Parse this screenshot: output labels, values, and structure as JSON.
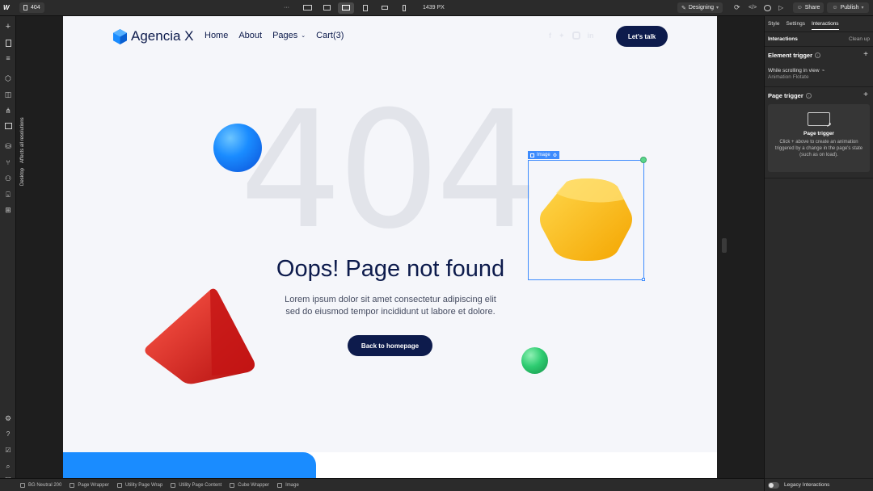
{
  "topbar": {
    "page_name": "404",
    "more": "···",
    "width_readout": "1439 PX",
    "mode_label": "Designing",
    "share_label": "Share",
    "publish_label": "Publish"
  },
  "canvas_side": {
    "affects_label": "Affects all resolutions",
    "breakpoint_label": "Desktop"
  },
  "site": {
    "brand": "Agencia X",
    "nav": [
      "Home",
      "About",
      "Pages",
      "Cart(3)"
    ],
    "cta": "Let's talk",
    "big_number": "404",
    "heading": "Oops! Page not found",
    "body_line1": "Lorem ipsum dolor sit amet consectetur adipiscing elit",
    "body_line2": "sed do eiusmod tempor incididunt ut labore et dolore.",
    "back_button": "Back to homepage",
    "selection_tag": "Image"
  },
  "rightpanel": {
    "tabs": [
      "Style",
      "Settings",
      "Interactions"
    ],
    "active_tab": "Interactions",
    "section_title": "Interactions",
    "cleanup": "Clean up",
    "element_trigger": "Element trigger",
    "trigger_item": "While scrolling in view",
    "trigger_sub": "Animation Flotate",
    "page_trigger": "Page trigger",
    "card_title": "Page trigger",
    "card_desc": "Click + above to create an animation triggered by a change in the page's state (such as on load).",
    "legacy": "Legacy Interactions"
  },
  "breadcrumbs": [
    "BG Neutral 200",
    "Page Wrapper",
    "Utility Page Wrap",
    "Utility Page Content",
    "Cube Wrapper",
    "Image"
  ],
  "colors": {
    "navy": "#0d1b4c",
    "accent_blue": "#1a8cff",
    "selection": "#3d8bfd",
    "yellow": "#ffc21a",
    "red": "#e02020",
    "green": "#2ecc71"
  }
}
